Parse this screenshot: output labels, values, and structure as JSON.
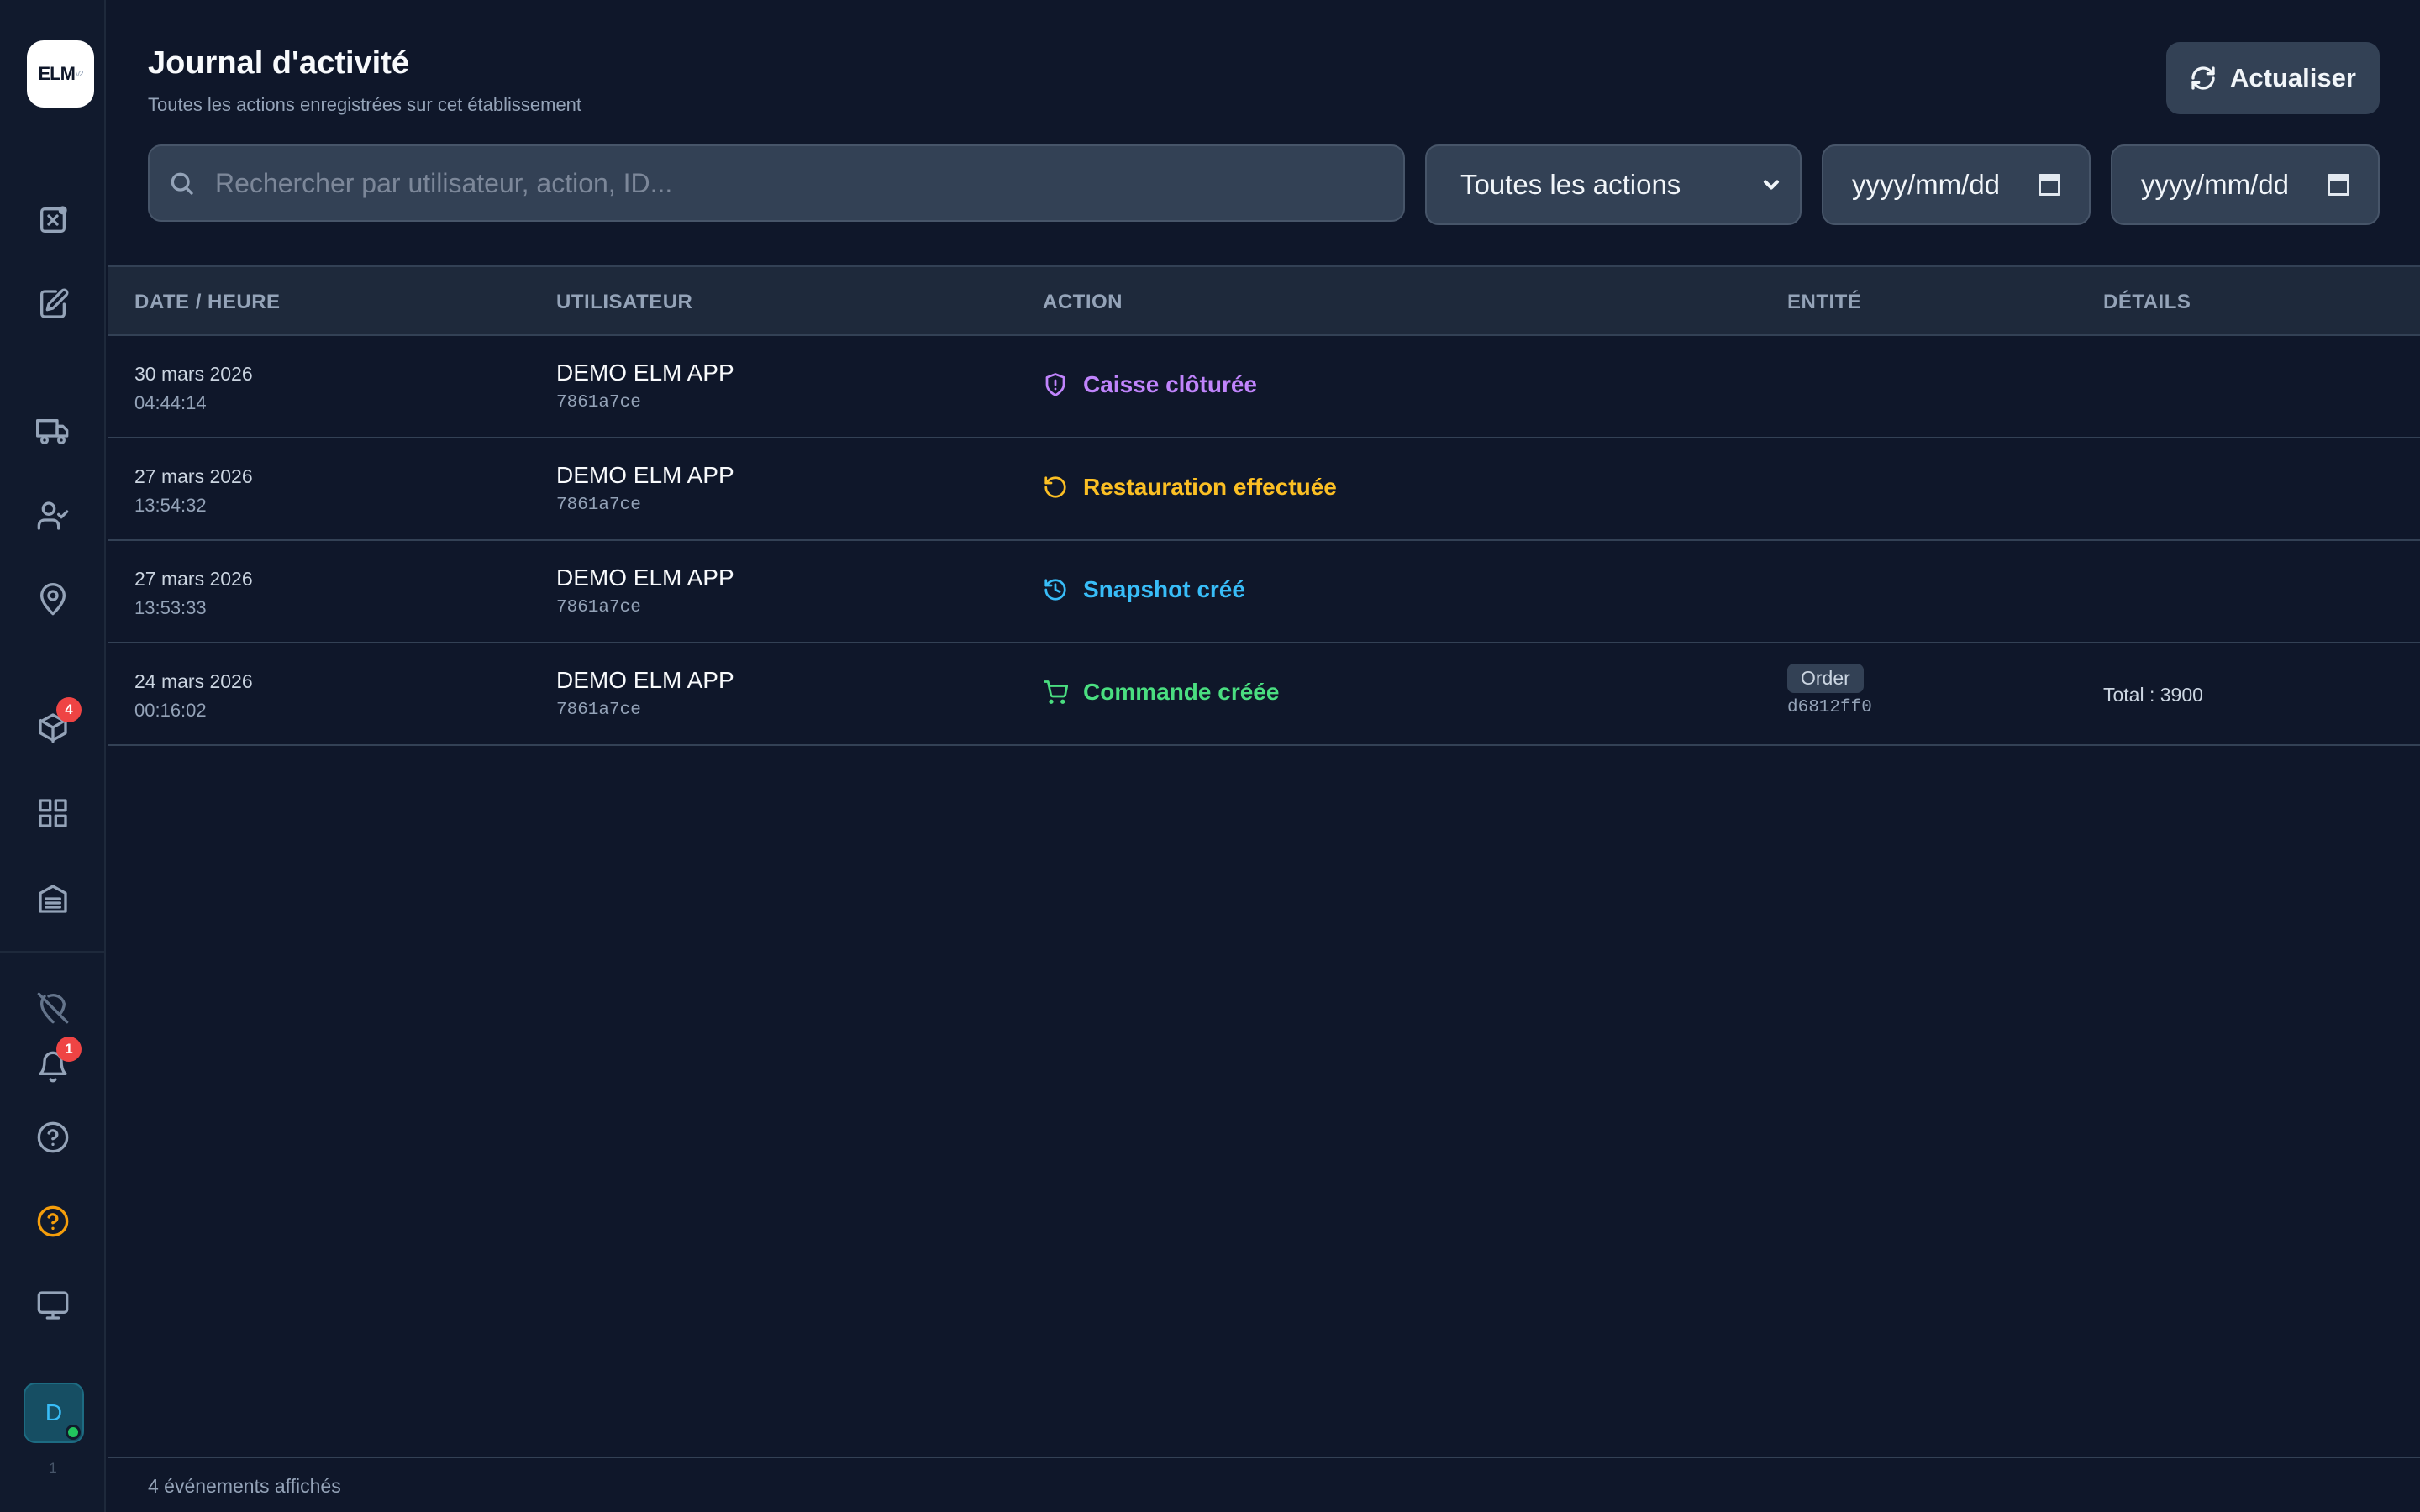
{
  "app": {
    "logo_text": "ELM",
    "logo_suffix": "v2"
  },
  "sidebar": {
    "badges": {
      "products": "4",
      "notifications": "1"
    },
    "avatar_initial": "D",
    "footer_text": "1"
  },
  "header": {
    "title": "Journal d'activité",
    "subtitle": "Toutes les actions enregistrées sur cet établissement",
    "refresh_label": "Actualiser"
  },
  "filters": {
    "search_placeholder": "Rechercher par utilisateur, action, ID...",
    "action_select": "Toutes les actions",
    "date_from": "yyyy/mm/dd",
    "date_to": "yyyy/mm/dd"
  },
  "table": {
    "columns": [
      "DATE / HEURE",
      "UTILISATEUR",
      "ACTION",
      "ENTITÉ",
      "DÉTAILS"
    ],
    "rows": [
      {
        "date": "30 mars 2026",
        "time": "04:44:14",
        "user": "DEMO ELM APP",
        "user_id": "7861a7ce",
        "action": "Caisse clôturée",
        "action_icon": "shield-alert-icon",
        "entity": "",
        "entity_id": "",
        "details": ""
      },
      {
        "date": "27 mars 2026",
        "time": "13:54:32",
        "user": "DEMO ELM APP",
        "user_id": "7861a7ce",
        "action": "Restauration effectuée",
        "action_icon": "rotate-ccw-icon",
        "entity": "",
        "entity_id": "",
        "details": ""
      },
      {
        "date": "27 mars 2026",
        "time": "13:53:33",
        "user": "DEMO ELM APP",
        "user_id": "7861a7ce",
        "action": "Snapshot créé",
        "action_icon": "history-icon",
        "entity": "",
        "entity_id": "",
        "details": ""
      },
      {
        "date": "24 mars 2026",
        "time": "00:16:02",
        "user": "DEMO ELM APP",
        "user_id": "7861a7ce",
        "action": "Commande créée",
        "action_icon": "cart-icon",
        "entity": "Order",
        "entity_id": "d6812ff0",
        "details": "Total : 3900"
      }
    ]
  },
  "footer": {
    "count_text": "4 événements affichés"
  },
  "colors": {
    "background": "#0f172a",
    "purple": "#c084fc",
    "amber": "#fbbf24",
    "sky": "#38bdf8",
    "green": "#4ade80",
    "badge": "#ef4444"
  }
}
